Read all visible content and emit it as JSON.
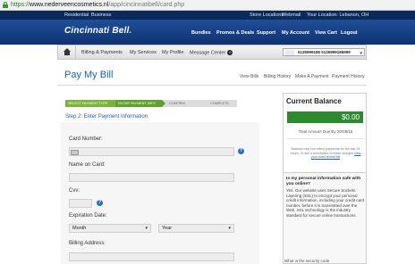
{
  "browser": {
    "url_scheme": "https://",
    "url_host": "www.nederveencosmetics.nl",
    "url_path": "/app/cincinnatibell/card.php"
  },
  "topnav": {
    "left": [
      "Residential",
      "Business"
    ],
    "right": [
      "Store Locations",
      "Webmail",
      "Your Location: Lebanon, OH"
    ]
  },
  "brand": {
    "logo": "Cincinnati Bell",
    "mark": "."
  },
  "mainnav": [
    "Bundles",
    "Promos & Deals",
    "Support",
    "My Account",
    "View Cart",
    "Logout"
  ],
  "subnav": {
    "items": [
      "Billing & Payments",
      "My Services",
      "My Profile",
      "Message Center"
    ],
    "message_count": "0",
    "account_number": "5135999186 5135999186999"
  },
  "page": {
    "title": "Pay My Bill",
    "links": [
      "View Bills",
      "Billing History",
      "Make A Payment",
      "Payment History"
    ]
  },
  "progress": {
    "steps": [
      "SELECT PAYMENT TYPE",
      "ENTER PAYMENT INFO",
      "CONFIRM",
      "COMPLETE"
    ]
  },
  "form": {
    "step_heading": "Step 2: Enter Payment Information",
    "card_number_label": "Card Number:",
    "name_label": "Name on Card:",
    "cvv_label": "Cvv:",
    "expiration_label": "Expiration Date:",
    "month_value": "Month",
    "year_value": "Year",
    "billing_label": "Billing Address:",
    "help_glyph": "?"
  },
  "balance": {
    "heading": "Current Balance",
    "amount": "$0.00",
    "due": "Total Amount Due By 20/08/15",
    "note": "Balance may not reflect payments for the last 24 hours. To see a description of these charges",
    "note_link": "view your most recent bill"
  },
  "faq": {
    "question": "Is my personal information safe with you online?",
    "answer": "Yes. Our website uses Secure Sockets Layering (SSL) to encrypt your personal credit information, including your credit card number, before it is transmitted over the Web. SSL technology is the industry standard for secure online transactions."
  },
  "footer_snippet": "What is the security code"
}
